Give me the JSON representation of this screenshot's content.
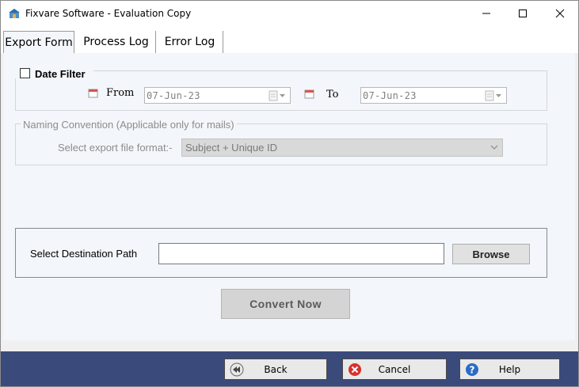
{
  "window": {
    "title": "Fixvare Software - Evaluation Copy",
    "controls": {
      "minimize": "minimize-icon",
      "maximize": "maximize-icon",
      "close": "close-icon"
    }
  },
  "tabs": [
    {
      "label": "Export Form",
      "active": true
    },
    {
      "label": "Process Log",
      "active": false
    },
    {
      "label": "Error Log",
      "active": false
    }
  ],
  "date_filter": {
    "label": "Date Filter",
    "checked": false,
    "from_label": "From",
    "from_value": "07-Jun-23",
    "to_label": "To",
    "to_value": "07-Jun-23"
  },
  "naming": {
    "group_label": "Naming Convention (Applicable only for mails)",
    "format_label": "Select export file format:-",
    "format_value": "Subject + Unique ID"
  },
  "destination": {
    "label": "Select Destination Path",
    "value": "",
    "browse_label": "Browse"
  },
  "convert_label": "Convert Now",
  "footer": {
    "back_label": "Back",
    "cancel_label": "Cancel",
    "help_label": "Help"
  },
  "colors": {
    "panel_bg": "#f3f6fa",
    "footer_bg": "#3a4a7a",
    "cancel_icon": "#d9302b",
    "help_icon": "#2a6cc4"
  }
}
